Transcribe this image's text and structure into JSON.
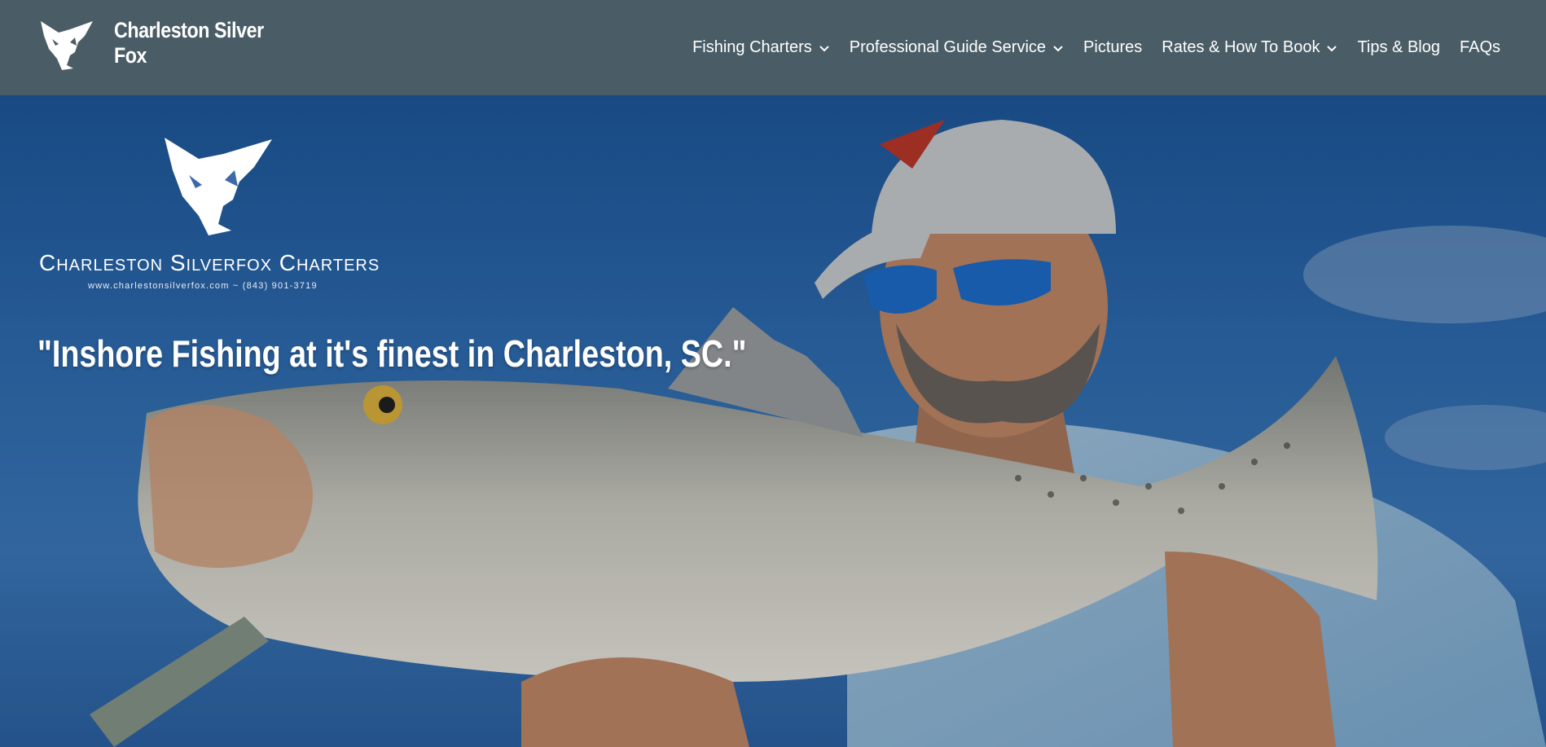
{
  "header": {
    "brand_name": "Charleston Silver Fox",
    "logo_icon": "fox-head-icon",
    "nav": [
      {
        "label": "Fishing Charters",
        "has_dropdown": true
      },
      {
        "label": "Professional Guide Service",
        "has_dropdown": true
      },
      {
        "label": "Pictures",
        "has_dropdown": false
      },
      {
        "label": "Rates & How To Book",
        "has_dropdown": true
      },
      {
        "label": "Tips & Blog",
        "has_dropdown": false
      },
      {
        "label": "FAQs",
        "has_dropdown": false
      }
    ]
  },
  "hero": {
    "logo_title": "Charleston Silverfox Charters",
    "logo_subtitle": "www.charlestonsilverfox.com ~ (843) 901-3719",
    "tagline": "\"Inshore Fishing at it's finest in Charleston, SC.\"",
    "image": "angler-holding-speckled-trout-photo"
  },
  "colors": {
    "header_bg": "#4a5d66",
    "text": "#ffffff",
    "sky_blue": "#2f6fb6"
  }
}
